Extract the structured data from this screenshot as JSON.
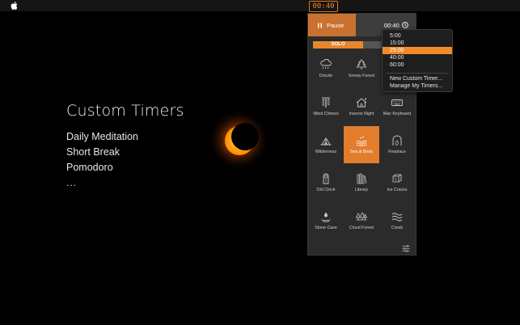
{
  "menubar": {
    "apple_icon": "apple-icon",
    "timer_text": "00:40"
  },
  "hero": {
    "title": "Custom Timers",
    "items": [
      "Daily Meditation",
      "Short Break",
      "Pomodoro"
    ],
    "more": "..."
  },
  "panel": {
    "pause_label": "Pause",
    "time_label": "00:40",
    "mode_tabs": [
      {
        "label": "SOLO"
      },
      {
        "label": ""
      }
    ],
    "accent_color": "#e27d2c",
    "sounds": [
      {
        "label": "Drizzle",
        "icon": "cloud-rain-icon"
      },
      {
        "label": "Snowy Forest",
        "icon": "snowy-tree-icon"
      },
      {
        "label": "",
        "icon": ""
      },
      {
        "label": "Wind Chimes",
        "icon": "wind-chimes-icon"
      },
      {
        "label": "Insects Night",
        "icon": "insect-house-icon"
      },
      {
        "label": "Mac Keyboard",
        "icon": "keyboard-icon"
      },
      {
        "label": "Wilderness",
        "icon": "tent-icon"
      },
      {
        "label": "Sea & Birds",
        "icon": "sea-birds-icon"
      },
      {
        "label": "Fireplace",
        "icon": "fireplace-icon"
      },
      {
        "label": "Old Clock",
        "icon": "grandfather-clock-icon"
      },
      {
        "label": "Library",
        "icon": "books-icon"
      },
      {
        "label": "Ice Cracks",
        "icon": "ice-cube-icon"
      },
      {
        "label": "Stone Cave",
        "icon": "cave-drop-icon"
      },
      {
        "label": "Cloud Forest",
        "icon": "forest-icon"
      },
      {
        "label": "Creek",
        "icon": "waves-icon"
      }
    ],
    "active_sound": "Sea & Birds"
  },
  "dropdown": {
    "times": [
      "5:00",
      "15:00",
      "25:00",
      "40:00",
      "60:00"
    ],
    "selected": "25:00",
    "actions": [
      "New Custom Timer...",
      "Manage My Timers..."
    ]
  }
}
